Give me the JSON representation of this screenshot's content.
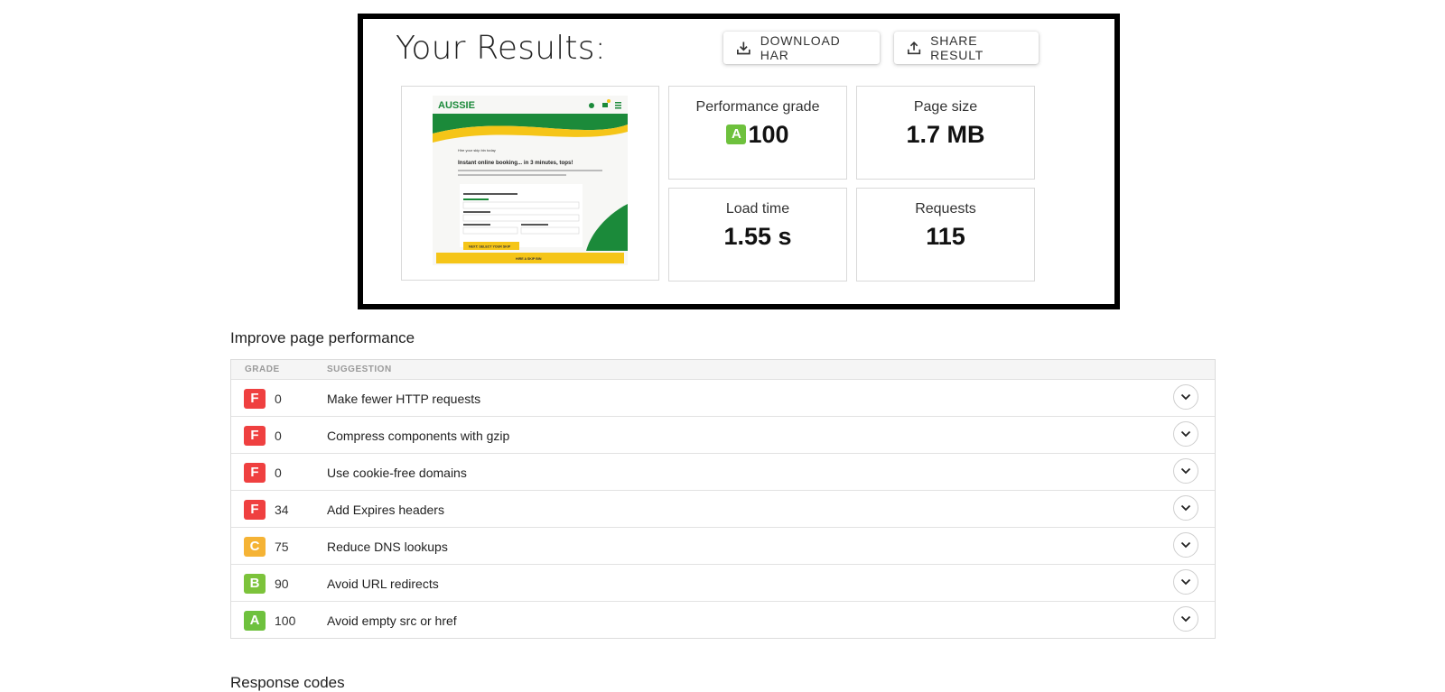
{
  "results": {
    "title": "Your Results:",
    "download_label": "DOWNLOAD HAR",
    "share_label": "SHARE RESULT",
    "metrics": {
      "performance": {
        "label": "Performance grade",
        "grade": "A",
        "value": "100"
      },
      "page_size": {
        "label": "Page size",
        "value": "1.7 MB"
      },
      "load_time": {
        "label": "Load time",
        "value": "1.55 s"
      },
      "requests": {
        "label": "Requests",
        "value": "115"
      }
    },
    "screenshot": {
      "logo_text": "AUSSIE",
      "heading": "Instant online booking... in 3 minutes, tops!",
      "button_next": "NEXT: SELECT YOUR SKIP",
      "button_hire": "HIRE A SKIP BIN"
    }
  },
  "improve": {
    "title": "Improve page performance",
    "columns": {
      "grade": "GRADE",
      "suggestion": "SUGGESTION"
    },
    "rows": [
      {
        "grade": "F",
        "score": "0",
        "suggestion": "Make fewer HTTP requests"
      },
      {
        "grade": "F",
        "score": "0",
        "suggestion": "Compress components with gzip"
      },
      {
        "grade": "F",
        "score": "0",
        "suggestion": "Use cookie-free domains"
      },
      {
        "grade": "F",
        "score": "34",
        "suggestion": "Add Expires headers"
      },
      {
        "grade": "C",
        "score": "75",
        "suggestion": "Reduce DNS lookups"
      },
      {
        "grade": "B",
        "score": "90",
        "suggestion": "Avoid URL redirects"
      },
      {
        "grade": "A",
        "score": "100",
        "suggestion": "Avoid empty src or href"
      }
    ]
  },
  "response_codes": {
    "title": "Response codes"
  },
  "colors": {
    "grade_F": "#ef4040",
    "grade_C": "#f5b335",
    "grade_B": "#7cc33b",
    "grade_A": "#6ec13d"
  }
}
